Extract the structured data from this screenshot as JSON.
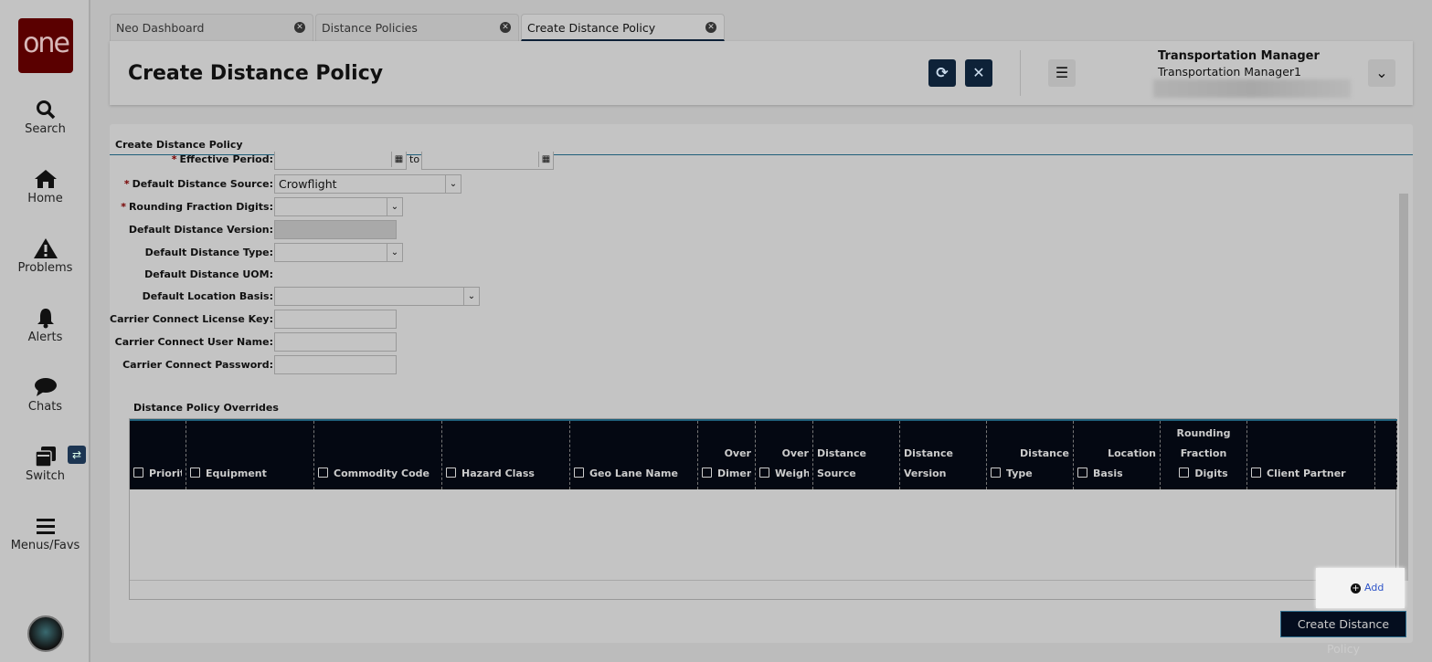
{
  "sidebar": {
    "logo": "one",
    "items": [
      {
        "label": "Search",
        "icon": "search-icon"
      },
      {
        "label": "Home",
        "icon": "home-icon"
      },
      {
        "label": "Problems",
        "icon": "warning-icon"
      },
      {
        "label": "Alerts",
        "icon": "bell-icon"
      },
      {
        "label": "Chats",
        "icon": "chat-icon"
      },
      {
        "label": "Switch",
        "icon": "switch-icon"
      },
      {
        "label": "Menus/Favs",
        "icon": "menu-icon"
      }
    ],
    "switch_badge": "⇄"
  },
  "tabs": [
    {
      "label": "Neo Dashboard"
    },
    {
      "label": "Distance Policies"
    },
    {
      "label": "Create Distance Policy",
      "active": true
    }
  ],
  "header": {
    "title": "Create Distance Policy",
    "user_role": "Transportation Manager",
    "user_name": "Transportation Manager1"
  },
  "form": {
    "section_title": "Create Distance Policy",
    "fields": [
      {
        "label": "Effective Period:",
        "required": true,
        "to_label": "to"
      },
      {
        "label": "Default Distance Source:",
        "required": true,
        "value": "Crowflight"
      },
      {
        "label": "Rounding Fraction Digits:",
        "required": true,
        "value": ""
      },
      {
        "label": "Default Distance Version:",
        "value": ""
      },
      {
        "label": "Default Distance Type:",
        "value": ""
      },
      {
        "label": "Default Distance UOM:"
      },
      {
        "label": "Default Location Basis:",
        "value": ""
      },
      {
        "label": "Carrier Connect License Key:",
        "value": ""
      },
      {
        "label": "Carrier Connect User Name:",
        "value": ""
      },
      {
        "label": "Carrier Connect Password:",
        "value": ""
      }
    ]
  },
  "overrides": {
    "title": "Distance Policy Overrides",
    "columns": [
      [
        "",
        "Priorit"
      ],
      [
        "",
        "Equipment"
      ],
      [
        "",
        "Commodity Code"
      ],
      [
        "",
        "Hazard Class"
      ],
      [
        "",
        "Geo Lane Name"
      ],
      [
        "Over",
        "Dimen"
      ],
      [
        "Over",
        "Weigh"
      ],
      [
        "Distance",
        "Source"
      ],
      [
        "Distance",
        "Version"
      ],
      [
        "Distance",
        "Type"
      ],
      [
        "Location",
        "Basis"
      ],
      [
        "Rounding Fraction",
        "Digits"
      ],
      [
        "",
        "Client Partner"
      ]
    ],
    "add_label": "Add"
  },
  "actions": {
    "create_label": "Create Distance Policy"
  }
}
